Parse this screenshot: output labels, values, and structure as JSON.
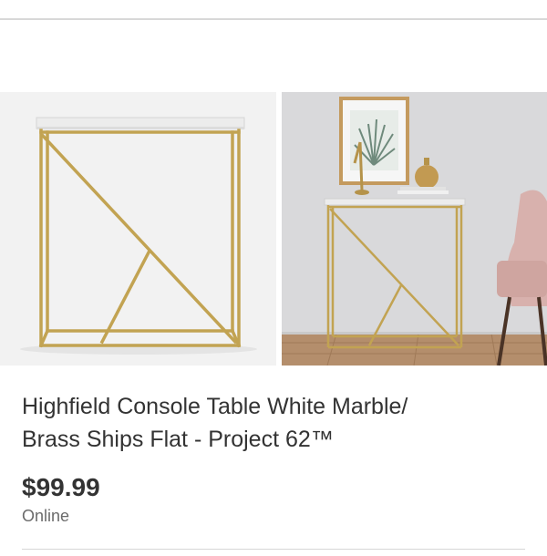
{
  "product": {
    "title_line1": "Highfield Console Table White Marble/",
    "title_line2": "Brass Ships Flat - Project 62™",
    "price": "$99.99",
    "availability": "Online"
  },
  "gallery": {
    "images": [
      {
        "name": "product-image-studio"
      },
      {
        "name": "product-image-room"
      }
    ]
  },
  "colors": {
    "brass": "#c2a352",
    "marble": "#ececec",
    "text": "#333333",
    "muted": "#6b6b6b"
  }
}
